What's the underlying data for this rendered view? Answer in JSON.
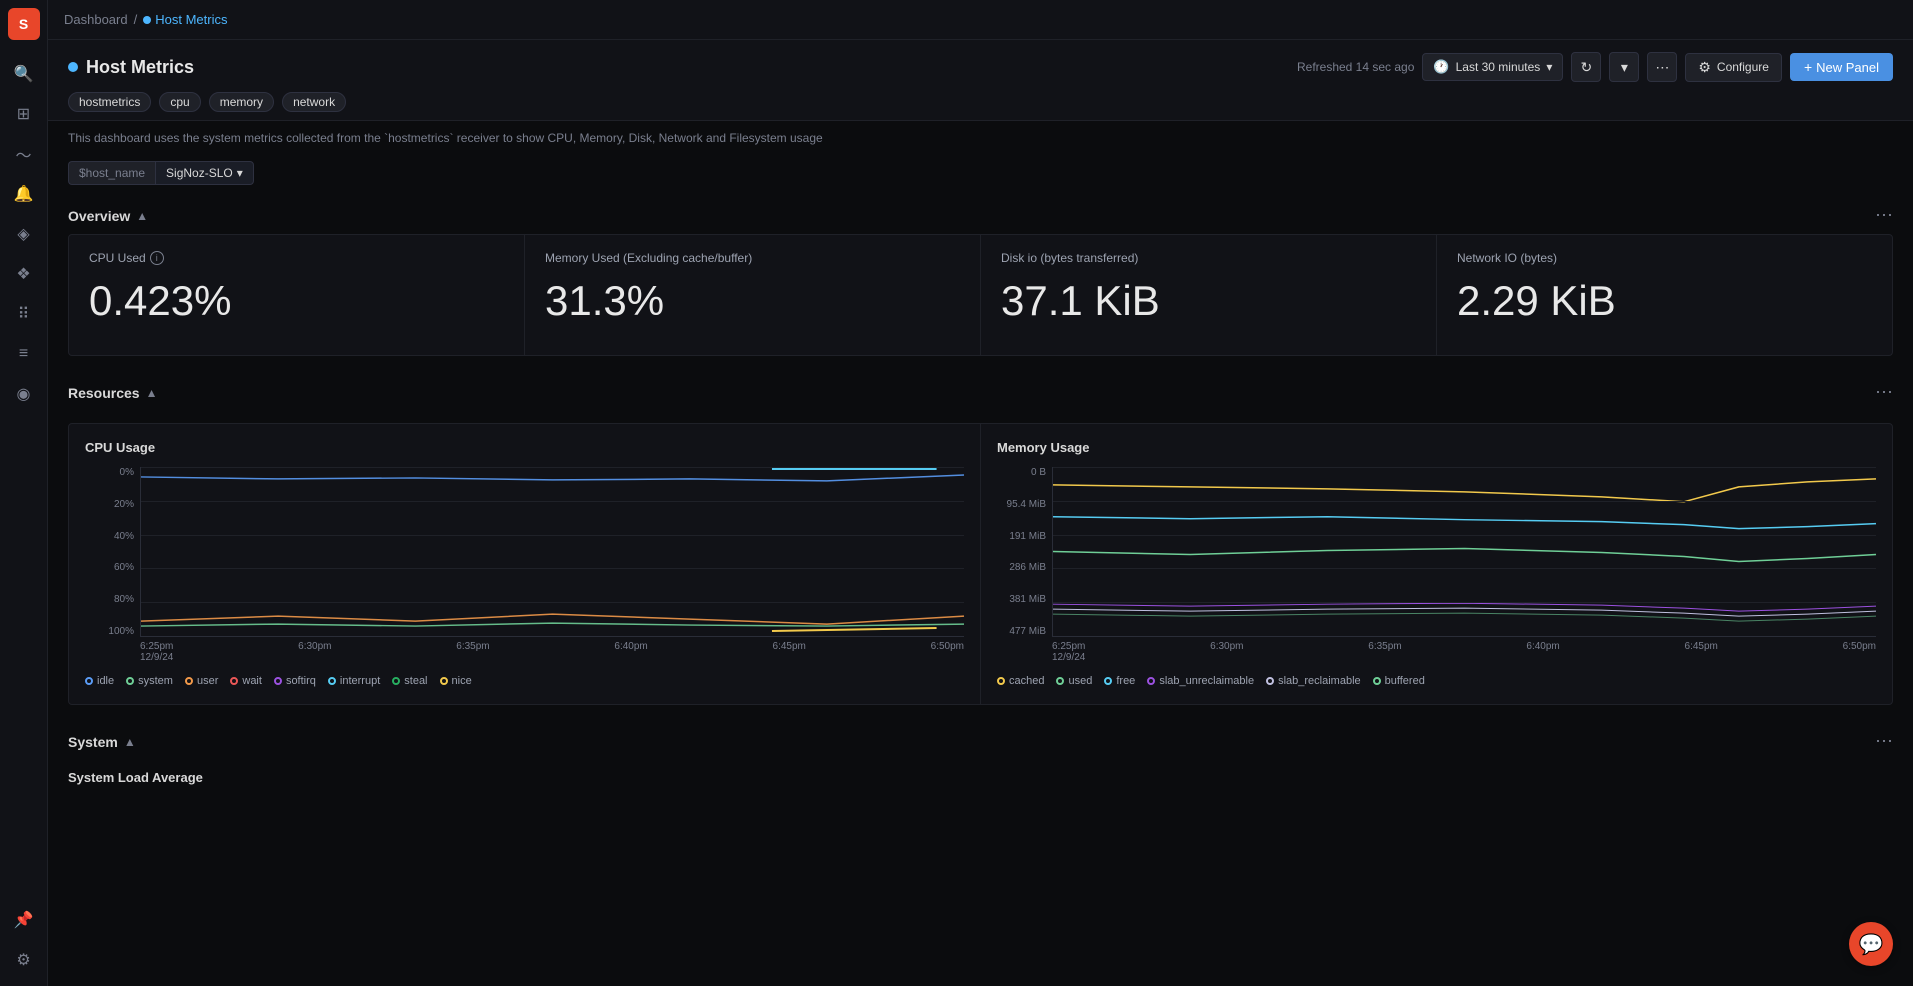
{
  "app": {
    "logo": "S",
    "logo_bg": "#e8462a"
  },
  "breadcrumb": {
    "root": "Dashboard",
    "separator": "/",
    "current": "Host Metrics",
    "current_dot_color": "#4db6ff"
  },
  "dashboard": {
    "title": "Host Metrics",
    "title_dot_color": "#4db6ff",
    "refreshed": "Refreshed 14 sec ago",
    "time_range": "Last 30 minutes",
    "configure_label": "Configure",
    "new_panel_label": "New Panel"
  },
  "tags": [
    "hostmetrics",
    "cpu",
    "memory",
    "network"
  ],
  "description": "This dashboard uses the system metrics collected from the `hostmetrics` receiver to show CPU, Memory, Disk, Network and Filesystem usage",
  "filter": {
    "label": "$host_name",
    "value": "SigNoz-SLO"
  },
  "sections": {
    "overview": {
      "title": "Overview",
      "menu": "⋯"
    },
    "resources": {
      "title": "Resources",
      "menu": "⋯"
    },
    "system": {
      "title": "System",
      "menu": "⋯"
    }
  },
  "stats": [
    {
      "title": "CPU Used",
      "value": "0.423%",
      "has_info": true
    },
    {
      "title": "Memory Used (Excluding cache/buffer)",
      "value": "31.3%",
      "has_info": false
    },
    {
      "title": "Disk io (bytes transferred)",
      "value": "37.1 KiB",
      "has_info": false
    },
    {
      "title": "Network IO (bytes)",
      "value": "2.29 KiB",
      "has_info": false
    }
  ],
  "cpu_chart": {
    "title": "CPU Usage",
    "y_labels": [
      "100%",
      "80%",
      "60%",
      "40%",
      "20%",
      "0%"
    ],
    "x_labels": [
      "6:25pm\n12/9/24",
      "6:30pm",
      "6:35pm",
      "6:40pm",
      "6:45pm",
      "6:50pm"
    ],
    "legend": [
      {
        "label": "idle",
        "color": "#5b9cf6"
      },
      {
        "label": "system",
        "color": "#6fcf97"
      },
      {
        "label": "user",
        "color": "#f2994a"
      },
      {
        "label": "wait",
        "color": "#eb5757"
      },
      {
        "label": "softirq",
        "color": "#9b51e0"
      },
      {
        "label": "interrupt",
        "color": "#56ccf2"
      },
      {
        "label": "steal",
        "color": "#27ae60"
      },
      {
        "label": "nice",
        "color": "#f2c94c"
      }
    ]
  },
  "memory_chart": {
    "title": "Memory Usage",
    "y_labels": [
      "477 MiB",
      "381 MiB",
      "286 MiB",
      "191 MiB",
      "95.4 MiB",
      "0 B"
    ],
    "x_labels": [
      "6:25pm\n12/9/24",
      "6:30pm",
      "6:35pm",
      "6:40pm",
      "6:45pm",
      "6:50pm"
    ],
    "legend": [
      {
        "label": "cached",
        "color": "#f2c94c"
      },
      {
        "label": "used",
        "color": "#6fcf97"
      },
      {
        "label": "free",
        "color": "#56ccf2"
      },
      {
        "label": "slab_unreclaimable",
        "color": "#9b51e0"
      },
      {
        "label": "slab_reclaimable",
        "color": "#c0c0e0"
      },
      {
        "label": "buffered",
        "color": "#6fcf97"
      }
    ]
  },
  "system_section": {
    "load_title": "System Load Average"
  },
  "sidebar_icons": [
    {
      "name": "search",
      "symbol": "⌕",
      "active": false
    },
    {
      "name": "dashboard",
      "symbol": "⊞",
      "active": false
    },
    {
      "name": "activity",
      "symbol": "〜",
      "active": false
    },
    {
      "name": "alert",
      "symbol": "🔔",
      "active": false
    },
    {
      "name": "services",
      "symbol": "⚙",
      "active": false
    },
    {
      "name": "integrations",
      "symbol": "❖",
      "active": false
    },
    {
      "name": "grid",
      "symbol": "⋮⋮",
      "active": false
    },
    {
      "name": "list",
      "symbol": "≡",
      "active": false
    },
    {
      "name": "telescope",
      "symbol": "◎",
      "active": false
    },
    {
      "name": "pin",
      "symbol": "📌",
      "active": false
    },
    {
      "name": "settings2",
      "symbol": "⚙",
      "active": false
    }
  ]
}
